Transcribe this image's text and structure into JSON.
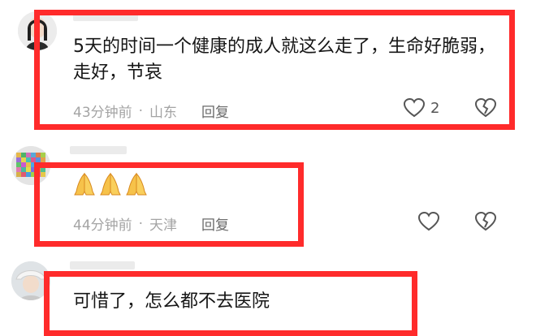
{
  "comments": [
    {
      "text": "5天的时间一个健康的成人就这么走了，生命好脆弱，走好，节哀",
      "time": "43分钟前",
      "separator": "·",
      "location": "山东",
      "reply_label": "回复",
      "like_count": "2"
    },
    {
      "emoji": [
        "pray-emoji",
        "pray-emoji",
        "pray-emoji"
      ],
      "time": "44分钟前",
      "separator": "·",
      "location": "天津",
      "reply_label": "回复"
    },
    {
      "text": "可惜了，怎么都不去医院"
    }
  ],
  "colors": {
    "highlight": "#ff2b2b",
    "meta": "#a4a4a4"
  }
}
